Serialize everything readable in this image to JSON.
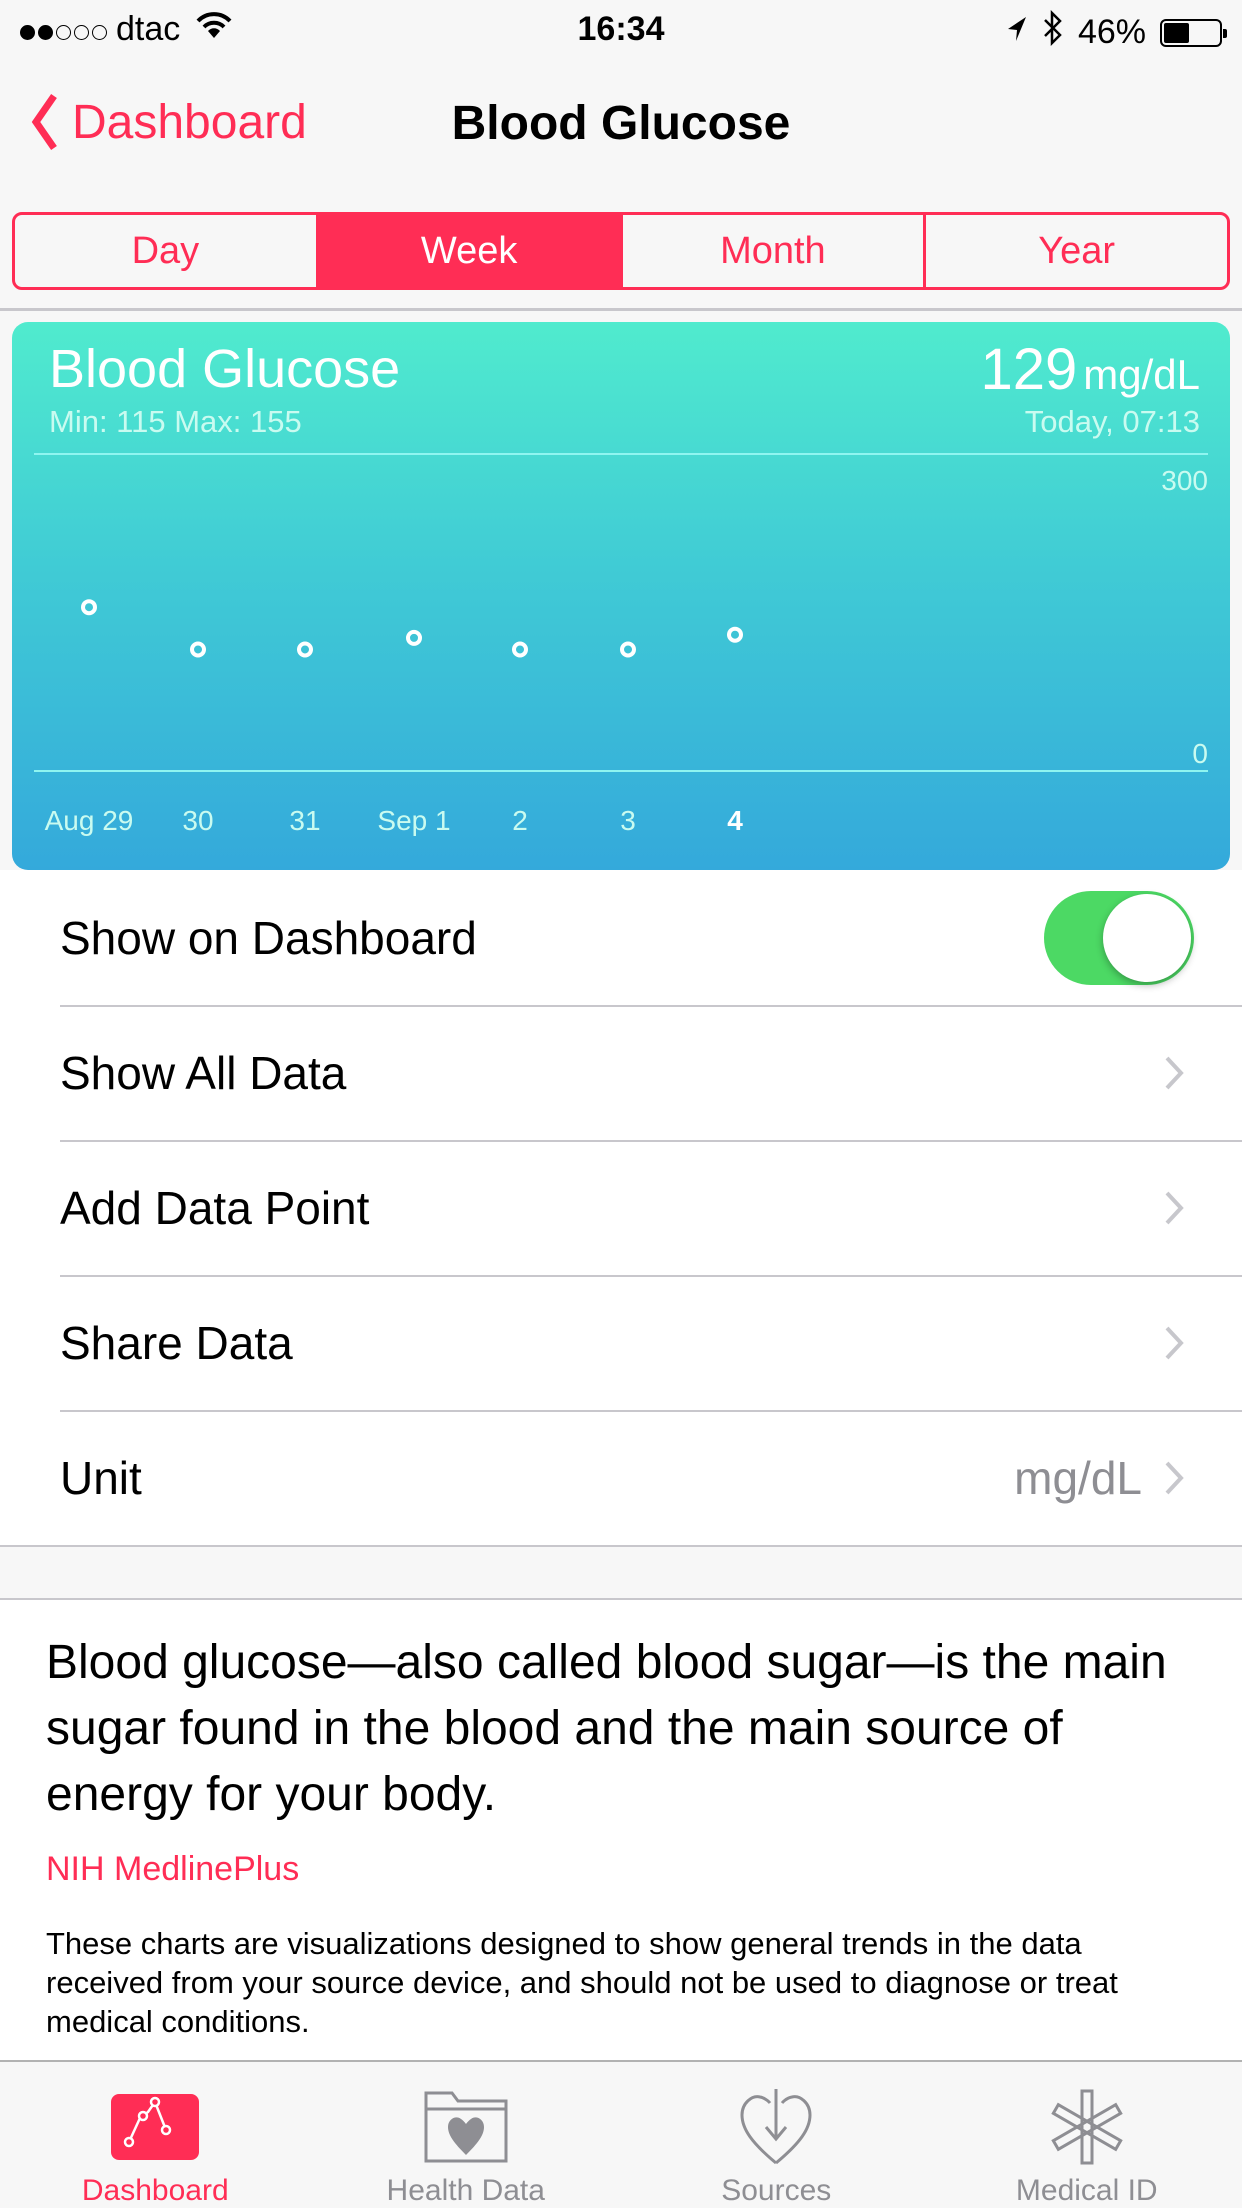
{
  "status_bar": {
    "signal_bars_filled": 2,
    "signal_bars_total": 5,
    "carrier": "dtac",
    "time": "16:34",
    "battery_percent_label": "46%",
    "battery_level": 0.46,
    "icons": [
      "wifi-icon",
      "location-arrow-icon",
      "bluetooth-icon",
      "battery-icon"
    ]
  },
  "nav": {
    "back_label": "Dashboard",
    "title": "Blood Glucose"
  },
  "segments": {
    "items": [
      "Day",
      "Week",
      "Month",
      "Year"
    ],
    "selected": "Week"
  },
  "card": {
    "title": "Blood Glucose",
    "min_max": "Min: 115  Max: 155",
    "latest_value": "129",
    "latest_unit": "mg/dL",
    "latest_time": "Today, 07:13"
  },
  "chart_data": {
    "type": "scatter",
    "title": "Blood Glucose",
    "categories": [
      "Aug 29",
      "30",
      "31",
      "Sep 1",
      "2",
      "3",
      "4"
    ],
    "highlighted_category": "4",
    "values": [
      155,
      115,
      115,
      126,
      115,
      115,
      129
    ],
    "ylabel": "mg/dL",
    "ylim": [
      0,
      300
    ],
    "y_tick_labels": [
      "300",
      "0"
    ],
    "grid": false,
    "legend": "none"
  },
  "list": {
    "rows": [
      {
        "label": "Show on Dashboard",
        "type": "toggle",
        "toggle_on": true
      },
      {
        "label": "Show All Data",
        "type": "disclosure"
      },
      {
        "label": "Add Data Point",
        "type": "disclosure"
      },
      {
        "label": "Share Data",
        "type": "disclosure"
      },
      {
        "label": "Unit",
        "type": "disclosure",
        "value": "mg/dL"
      }
    ]
  },
  "description": {
    "main": "Blood glucose—also called blood sugar—is the main sugar found in the blood and the main source of energy for your body.",
    "source": "NIH MedlinePlus",
    "disclaimer": "These charts are visualizations designed to show general trends in the data received from your source device, and should not be used to diagnose or treat medical conditions."
  },
  "tabbar": {
    "items": [
      {
        "label": "Dashboard",
        "icon": "dashboard-chart-icon",
        "active": true
      },
      {
        "label": "Health Data",
        "icon": "health-data-folder-icon",
        "active": false
      },
      {
        "label": "Sources",
        "icon": "sources-heart-arrow-icon",
        "active": false
      },
      {
        "label": "Medical ID",
        "icon": "medical-id-asterisk-icon",
        "active": false
      }
    ]
  },
  "colors": {
    "accent": "#ff2d55",
    "toggle_on": "#4cd964",
    "card_gradient_top": "#50ebce",
    "card_gradient_bottom": "#34a9db"
  }
}
